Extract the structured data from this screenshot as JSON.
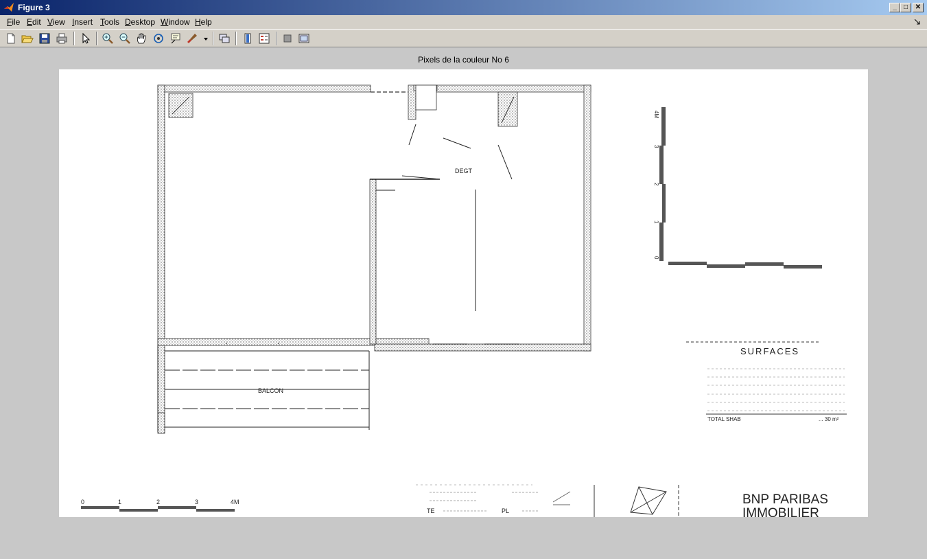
{
  "window": {
    "title": "Figure 3",
    "controls": [
      "minimize",
      "maximize",
      "close"
    ]
  },
  "menu": {
    "items": [
      "File",
      "Edit",
      "View",
      "Insert",
      "Tools",
      "Desktop",
      "Window",
      "Help"
    ]
  },
  "toolbar": {
    "buttons": [
      "new-figure-icon",
      "open-file-icon",
      "save-icon",
      "print-icon",
      "pointer-icon",
      "zoom-in-icon",
      "zoom-out-icon",
      "pan-icon",
      "rotate-icon",
      "data-cursor-icon",
      "brush-icon",
      "link-icon",
      "colorbar-icon",
      "legend-icon",
      "hide-plot-tools-icon",
      "show-plot-tools-icon"
    ]
  },
  "figure": {
    "title": "Pixels de la couleur No 6",
    "plan_labels": {
      "degt": "DEGT",
      "balcon": "BALCON",
      "surfaces": "SURFACES",
      "total": "TOTAL SHAB",
      "total_value": "... 30 m²",
      "brand_line1": "BNP PARIBAS",
      "brand_line2": "IMMOBILIER",
      "scale_ticks": [
        "0",
        "1",
        "2",
        "3",
        "4M"
      ],
      "legend_codes": [
        "TE",
        "PL"
      ]
    }
  }
}
